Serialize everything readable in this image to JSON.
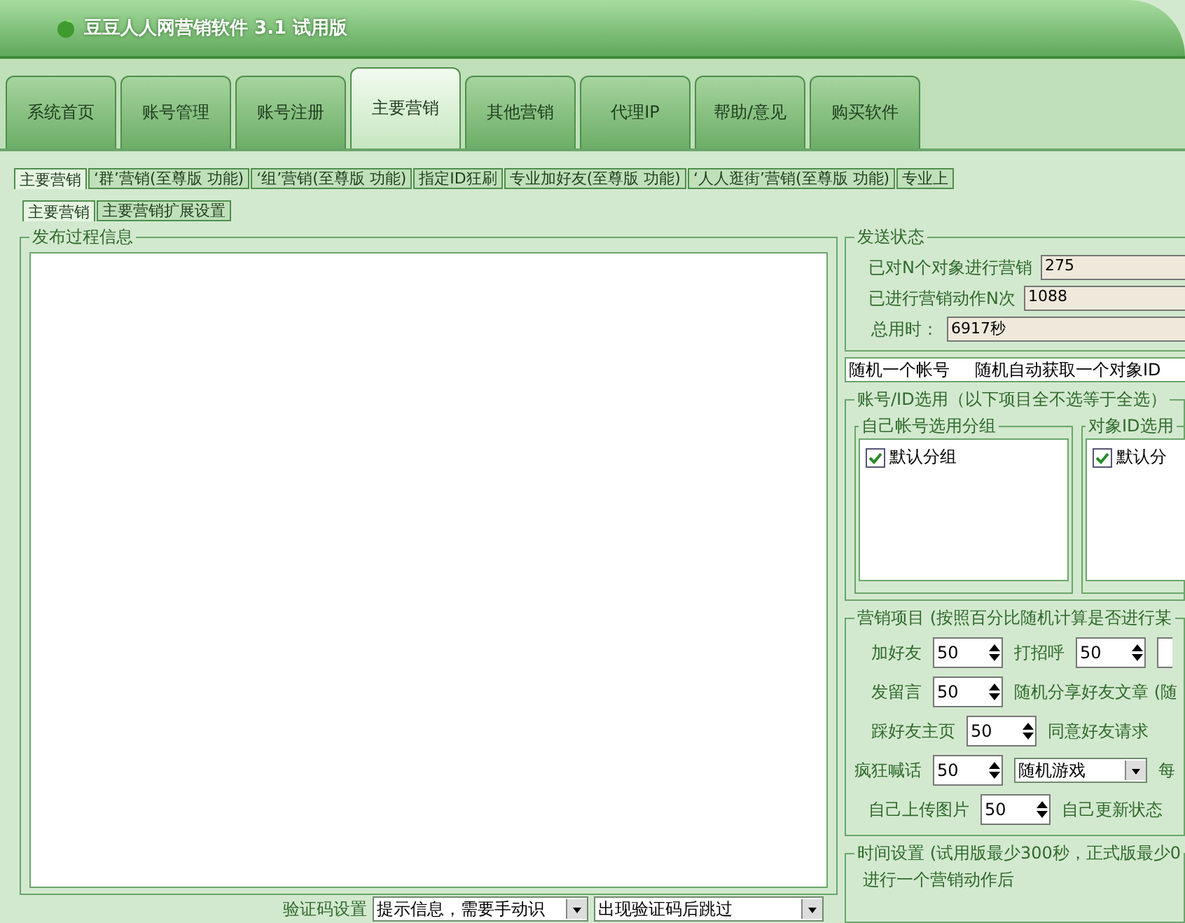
{
  "window": {
    "title": "豆豆人人网营销软件 3.1 试用版"
  },
  "main_tabs": [
    {
      "label": "系统首页",
      "selected": false
    },
    {
      "label": "账号管理",
      "selected": false
    },
    {
      "label": "账号注册",
      "selected": false
    },
    {
      "label": "主要营销",
      "selected": true
    },
    {
      "label": "其他营销",
      "selected": false
    },
    {
      "label": "代理IP",
      "selected": false
    },
    {
      "label": "帮助/意见",
      "selected": false
    },
    {
      "label": "购买软件",
      "selected": false
    }
  ],
  "sub_tabs": [
    {
      "label": "主要营销",
      "selected": true
    },
    {
      "label": "‘群’营销(至尊版 功能)",
      "selected": false
    },
    {
      "label": "‘组’营销(至尊版 功能)",
      "selected": false
    },
    {
      "label": "指定ID狂刷",
      "selected": false
    },
    {
      "label": "专业加好友(至尊版 功能)",
      "selected": false
    },
    {
      "label": "‘人人逛街’营销(至尊版 功能)",
      "selected": false
    },
    {
      "label": "专业上",
      "selected": false
    }
  ],
  "inner_tabs": [
    {
      "label": "主要营销",
      "selected": true
    },
    {
      "label": "主要营销扩展设置",
      "selected": false
    }
  ],
  "log_panel": {
    "title": "发布过程信息"
  },
  "captcha": {
    "label": "验证码设置",
    "mode": "提示信息，需要手动识",
    "action": "出现验证码后跳过"
  },
  "send_status": {
    "title": "发送状态",
    "rows": [
      {
        "label": "已对N个对象进行营销",
        "value": "275"
      },
      {
        "label": "已进行营销动作N次",
        "value": "1088"
      },
      {
        "label": "总用时：",
        "value": "6917秒"
      }
    ]
  },
  "mode_line": [
    "随机一个帐号",
    "随机自动获取一个对象ID"
  ],
  "selection": {
    "title": "账号/ID选用（以下项目全不选等于全选）",
    "groups": [
      {
        "title": "自己帐号选用分组",
        "items": [
          {
            "label": "默认分组",
            "checked": true
          }
        ]
      },
      {
        "title": "对象ID选用",
        "items": [
          {
            "label": "默认分",
            "checked": true
          }
        ]
      }
    ]
  },
  "marketing": {
    "title": "营销项目 (按照百分比随机计算是否进行某",
    "rows": [
      [
        {
          "kind": "spin",
          "label": "加好友",
          "value": "50"
        },
        {
          "kind": "spin",
          "label": "打招呼",
          "value": "50"
        },
        {
          "kind": "clipped"
        }
      ],
      [
        {
          "kind": "spin",
          "label": "发留言",
          "value": "50"
        },
        {
          "kind": "text",
          "label": "随机分享好友文章 (随"
        }
      ],
      [
        {
          "kind": "spin",
          "label": "踩好友主页",
          "value": "50"
        },
        {
          "kind": "text",
          "label": "同意好友请求"
        }
      ],
      [
        {
          "kind": "spin",
          "label": "疯狂喊话",
          "value": "50"
        },
        {
          "kind": "select",
          "value": "随机游戏"
        },
        {
          "kind": "text",
          "label": "每"
        }
      ],
      [
        {
          "kind": "spin",
          "label": "自己上传图片",
          "value": "50"
        },
        {
          "kind": "text",
          "label": "自己更新状态"
        }
      ]
    ]
  },
  "timing": {
    "title": "时间设置 (试用版最少300秒，正式版最少0",
    "text": "进行一个营销动作后"
  }
}
